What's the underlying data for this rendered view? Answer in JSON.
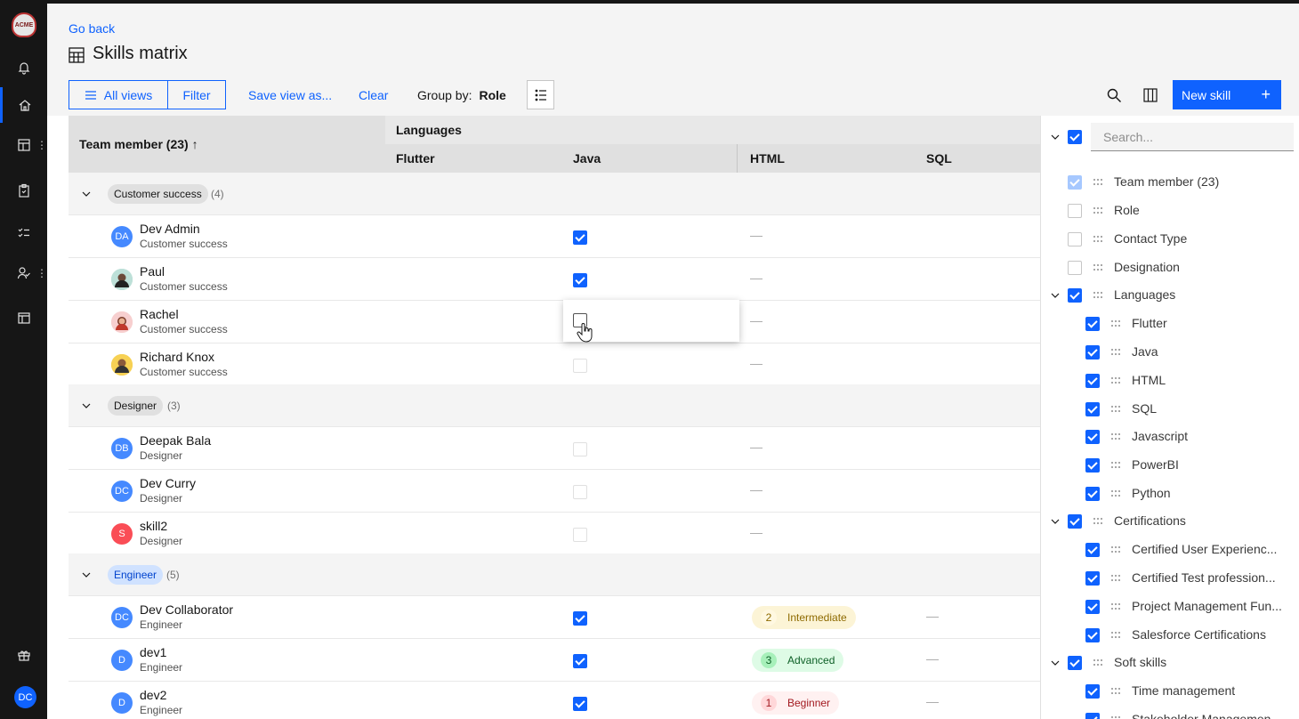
{
  "app": {
    "logo_text": "ACME",
    "user_initials": "DC"
  },
  "header": {
    "go_back": "Go back",
    "title": "Skills matrix",
    "all_views": "All views",
    "filter": "Filter",
    "save_view": "Save view as...",
    "clear": "Clear",
    "group_by_label": "Group by:",
    "group_by_value": "Role",
    "new_skill": "New skill"
  },
  "table": {
    "member_header": "Team member (23)",
    "group_header": "Languages",
    "columns": [
      "Flutter",
      "Java",
      "HTML",
      "SQL"
    ],
    "groups": [
      {
        "name": "Customer success",
        "count": "(4)"
      },
      {
        "name": "Designer",
        "count": "(3)"
      },
      {
        "name": "Engineer",
        "count": "(5)"
      }
    ],
    "people": [
      {
        "initials": "DA",
        "name": "Dev Admin",
        "role": "Customer success",
        "java": "checked",
        "html": "—"
      },
      {
        "initials": "",
        "name": "Paul",
        "role": "Customer success",
        "java": "checked",
        "html": "—"
      },
      {
        "initials": "",
        "name": "Rachel",
        "role": "Customer success",
        "java": "editing",
        "html": "—"
      },
      {
        "initials": "",
        "name": "Richard Knox",
        "role": "Customer success",
        "java": "unchecked",
        "html": "—"
      },
      {
        "initials": "DB",
        "name": "Deepak Bala",
        "role": "Designer",
        "java": "unchecked",
        "html": "—"
      },
      {
        "initials": "DC",
        "name": "Dev Curry",
        "role": "Designer",
        "java": "unchecked",
        "html": "—"
      },
      {
        "initials": "S",
        "name": "skill2",
        "role": "Designer",
        "java": "unchecked",
        "html": "—"
      },
      {
        "initials": "DC",
        "name": "Dev Collaborator",
        "role": "Engineer",
        "java": "checked",
        "html_level": "2",
        "html_label": "Intermediate",
        "sql": "—"
      },
      {
        "initials": "D",
        "name": "dev1",
        "role": "Engineer",
        "java": "checked",
        "html_level": "3",
        "html_label": "Advanced",
        "sql": "—"
      },
      {
        "initials": "D",
        "name": "dev2",
        "role": "Engineer",
        "java": "checked",
        "html_level": "1",
        "html_label": "Beginner",
        "sql": "—"
      }
    ]
  },
  "panel": {
    "search_placeholder": "Search...",
    "items": [
      {
        "label": "Team member (23)"
      },
      {
        "label": "Role"
      },
      {
        "label": "Contact Type"
      },
      {
        "label": "Designation"
      },
      {
        "label": "Languages"
      },
      {
        "label": "Flutter"
      },
      {
        "label": "Java"
      },
      {
        "label": "HTML"
      },
      {
        "label": "SQL"
      },
      {
        "label": "Javascript"
      },
      {
        "label": "PowerBI"
      },
      {
        "label": "Python"
      },
      {
        "label": "Certifications"
      },
      {
        "label": "Certified User Experienc..."
      },
      {
        "label": "Certified Test profession..."
      },
      {
        "label": "Project Management Fun..."
      },
      {
        "label": "Salesforce Certifications"
      },
      {
        "label": "Soft skills"
      },
      {
        "label": "Time management"
      },
      {
        "label": "Stakeholder Managemen..."
      }
    ]
  },
  "colors": {
    "accent": "#0f62fe",
    "rail": "#161616"
  }
}
